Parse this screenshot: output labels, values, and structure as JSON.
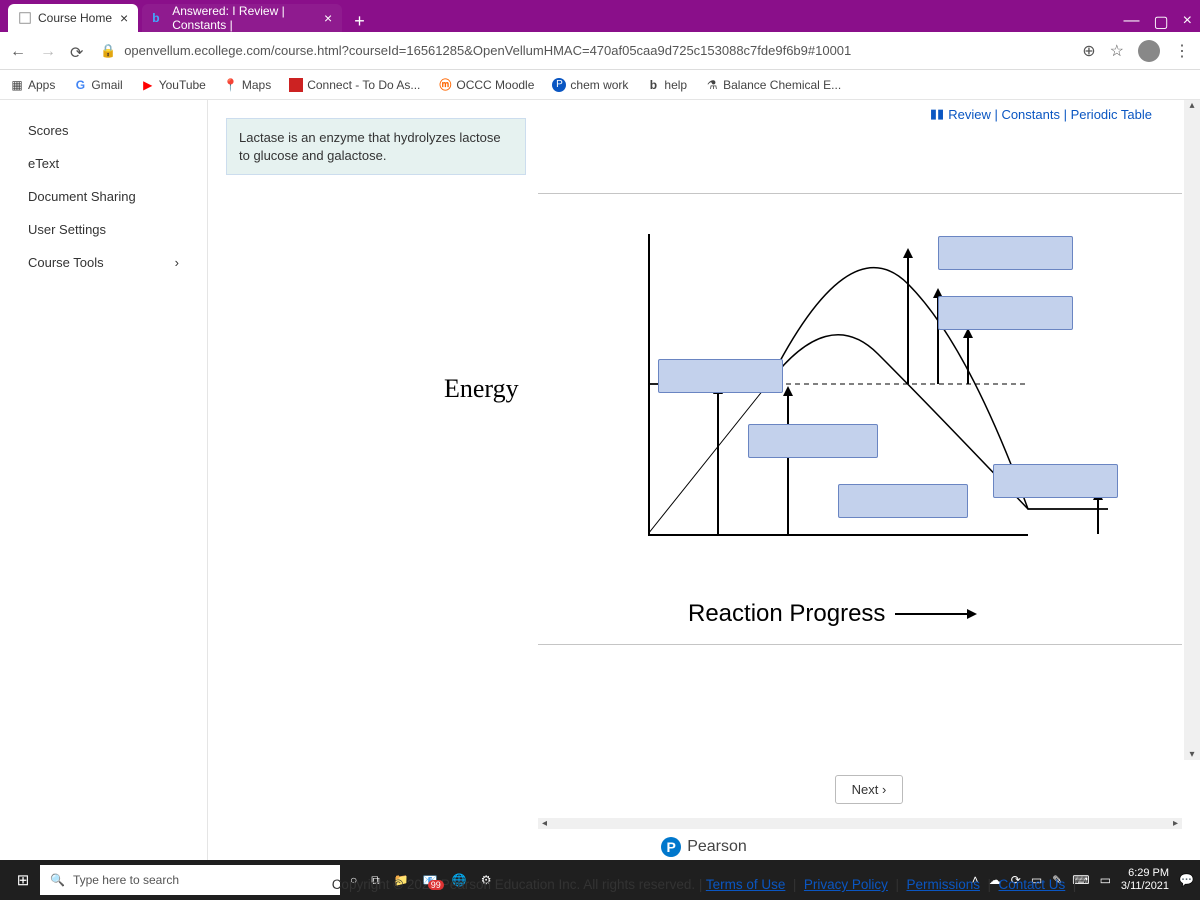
{
  "browser": {
    "tabs": [
      {
        "title": "Course Home",
        "active": true
      },
      {
        "title": "Answered: I Review | Constants |",
        "active": false,
        "prefix": "b"
      }
    ],
    "url": "openvellum.ecollege.com/course.html?courseId=16561285&OpenVellumHMAC=470af05caa9d725c153088c7fde9f6b9#10001",
    "bookmarks": [
      "Apps",
      "Gmail",
      "YouTube",
      "Maps",
      "Connect - To Do As...",
      "OCCC Moodle",
      "chem work",
      "help",
      "Balance Chemical E..."
    ]
  },
  "sidebar": {
    "items": [
      "Scores",
      "eText",
      "Document Sharing",
      "User Settings",
      "Course Tools"
    ]
  },
  "content": {
    "top_links": "Review | Constants | Periodic Table",
    "hint": "Lactase is an enzyme that hydrolyzes lactose to glucose and galactose.",
    "y_axis_label": "Energy",
    "x_axis_label": "Reaction Progress",
    "next_label": "Next",
    "brand": "Pearson",
    "copyright": "Copyright © 2021 Pearson Education Inc. All rights reserved. | ",
    "legal_links": [
      "Terms of Use",
      "Privacy Policy",
      "Permissions",
      "Contact Us"
    ]
  },
  "taskbar": {
    "search_placeholder": "Type here to search",
    "badge": "99",
    "time": "6:29 PM",
    "date": "3/11/2021"
  }
}
